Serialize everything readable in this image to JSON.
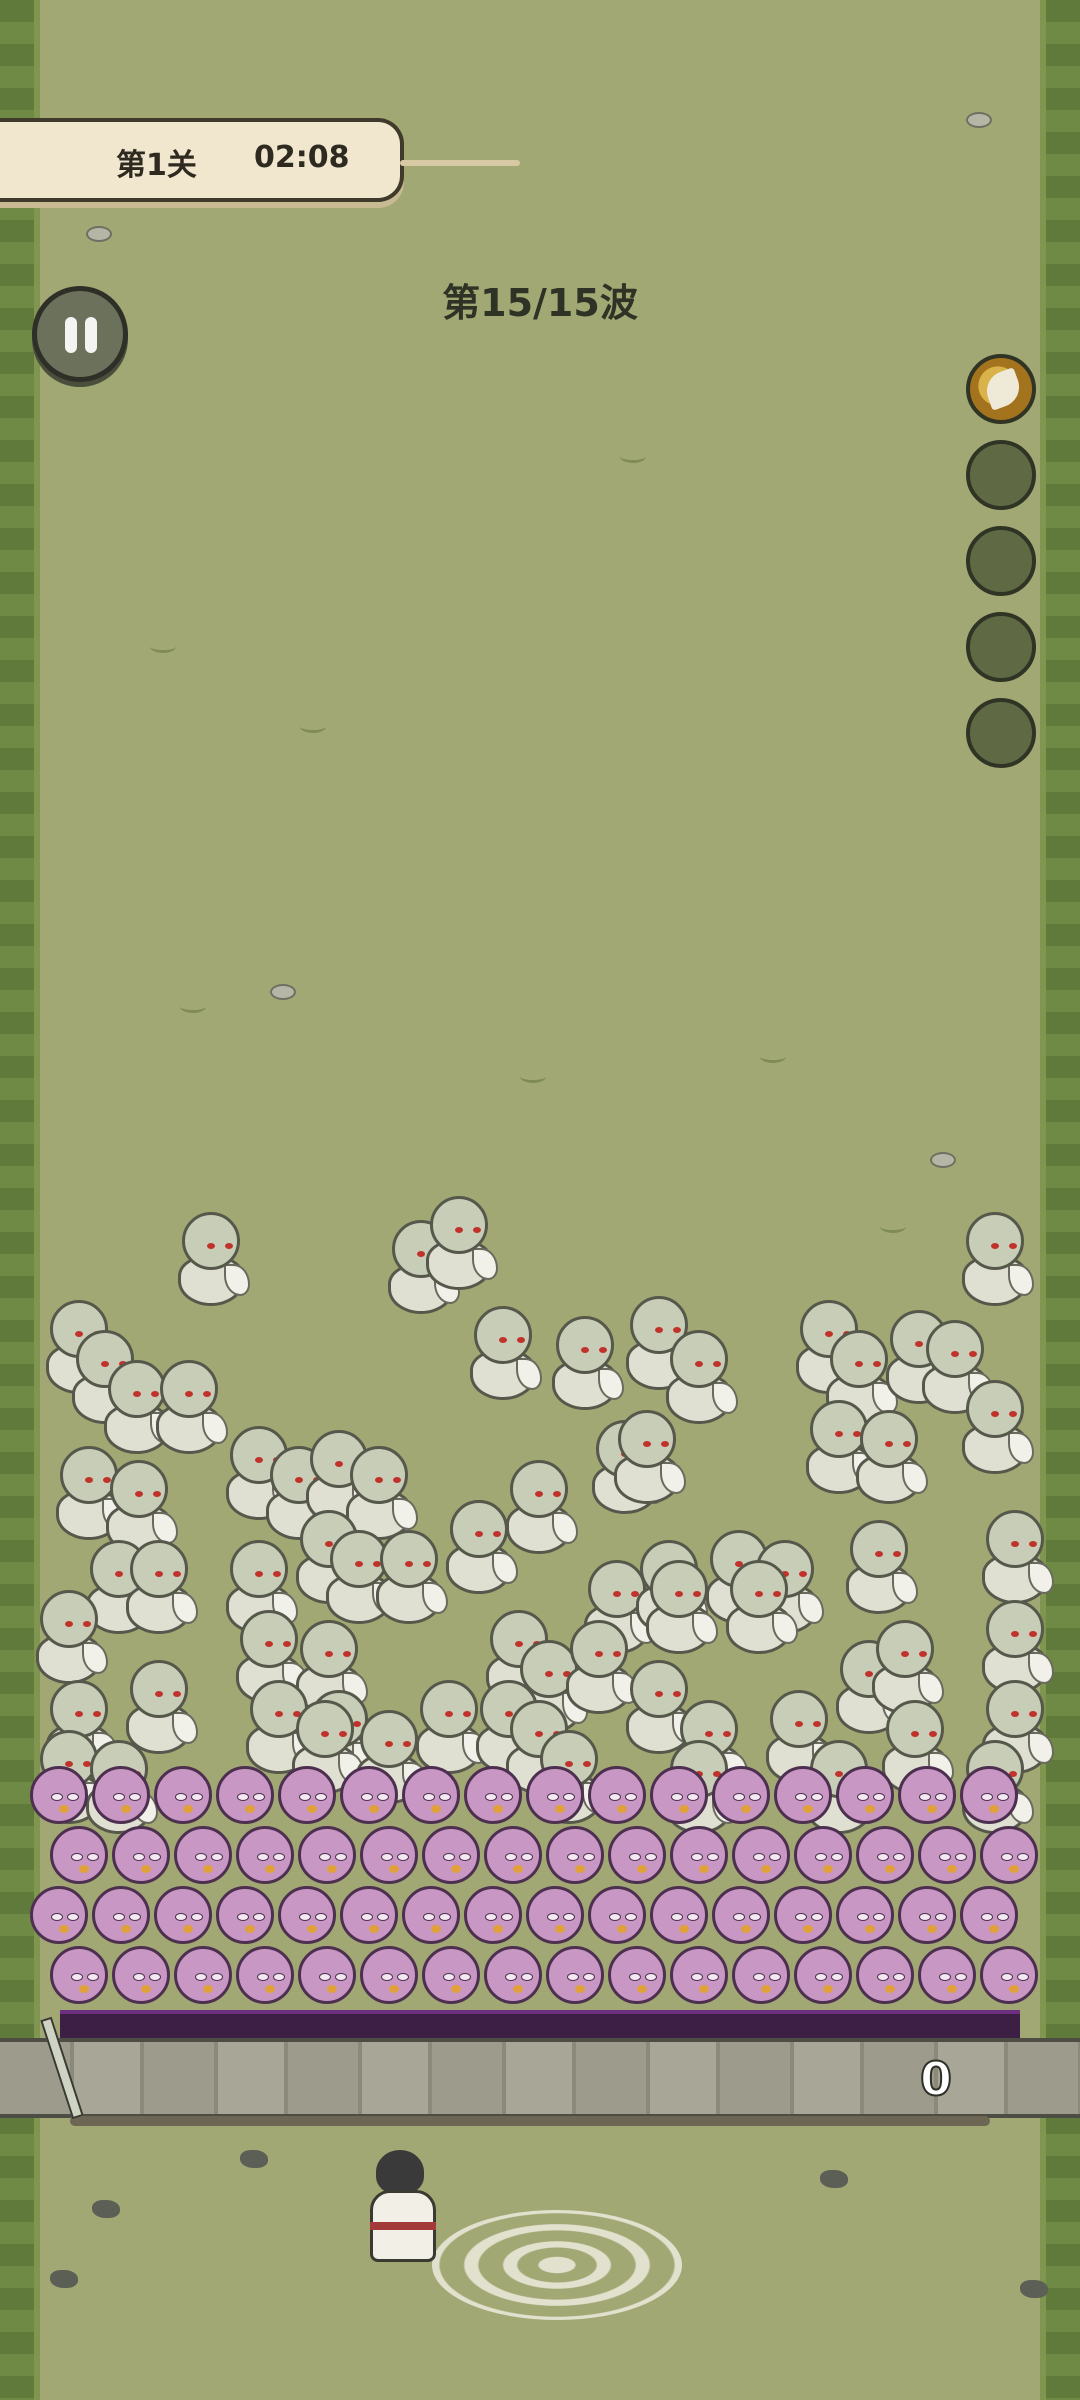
{
  "hud": {
    "level_label": "第1关",
    "timer": "02:08",
    "wave_label": "第15/15波",
    "score": "0"
  },
  "controls": {
    "pause_icon": "pause-icon"
  },
  "skills": {
    "slots": [
      {
        "state": "active",
        "icon": "wing-skill-icon"
      },
      {
        "state": "empty"
      },
      {
        "state": "empty"
      },
      {
        "state": "empty"
      },
      {
        "state": "empty"
      }
    ]
  },
  "colors": {
    "grass": "#a2a874",
    "barrier": "#3d1f46",
    "ghost_enemy": "#c8cdb7",
    "bird_enemy": "#c897c4"
  }
}
